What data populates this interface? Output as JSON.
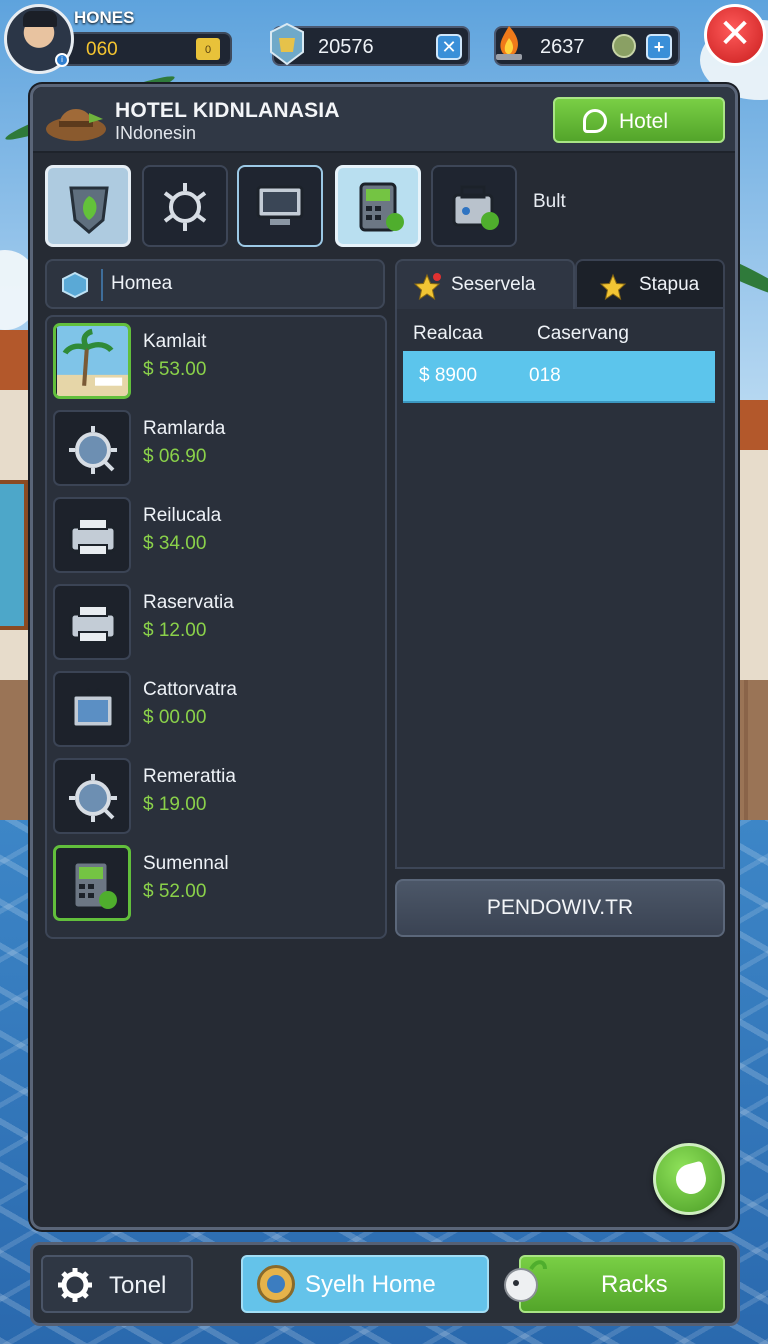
{
  "player": {
    "name": "HONES",
    "level": "060",
    "coin_badge": "0"
  },
  "resources": {
    "gems": {
      "value": "20576",
      "icon": "gem-badge-icon",
      "action_icon": "wrench-icon"
    },
    "fire": {
      "value": "2637",
      "icon": "campfire-icon",
      "action_icon": "plus-icon"
    }
  },
  "close_label": "✕",
  "panel": {
    "title": "HOTEL KIDNLANASIA",
    "subtitle": "INdonesin",
    "hotel_button": "Hotel",
    "category_label": "Bult",
    "categories": [
      {
        "icon": "shield-leaf-icon"
      },
      {
        "icon": "bug-gear-icon"
      },
      {
        "icon": "monitor-icon"
      },
      {
        "icon": "calculator-gear-icon"
      },
      {
        "icon": "machine-gear-icon"
      }
    ],
    "search_label": "Homea",
    "items": [
      {
        "name": "Kamlait",
        "price": "$ 53.00",
        "icon": "beach-palm-icon"
      },
      {
        "name": "Ramlarda",
        "price": "$ 06.90",
        "icon": "magnifier-gear-icon"
      },
      {
        "name": "Reilucala",
        "price": "$ 34.00",
        "icon": "printer-icon"
      },
      {
        "name": "Raservatia",
        "price": "$ 12.00",
        "icon": "printer-icon"
      },
      {
        "name": "Cattorvatra",
        "price": "$ 00.00",
        "icon": "tv-icon"
      },
      {
        "name": "Remerattia",
        "price": "$ 19.00",
        "icon": "magnifier-gear-icon"
      },
      {
        "name": "Sumennal",
        "price": "$ 52.00",
        "icon": "calculator-gear-icon"
      }
    ],
    "tabs": [
      {
        "label": "Seservela",
        "icon": "star-icon"
      },
      {
        "label": "Stapua",
        "icon": "star-icon"
      }
    ],
    "columns": [
      "Realcaa",
      "Caservang"
    ],
    "rows": [
      {
        "c1": "$ 8900",
        "c2": "018"
      }
    ],
    "pending_button": "PENDOWIV.TR"
  },
  "bottom_bar": {
    "tool": "Tonel",
    "home": "Syelh Home",
    "racks": "Racks"
  },
  "colors": {
    "accent_green": "#62bf3c",
    "accent_blue": "#5cc5ec",
    "price_green": "#8ad14a",
    "close_red": "#d62828"
  }
}
